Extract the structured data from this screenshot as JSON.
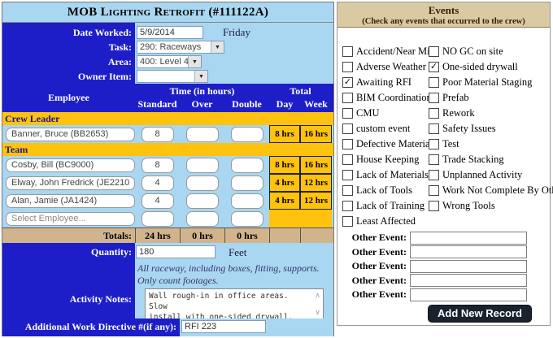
{
  "colors": {
    "dark_blue": "#1e1ec8",
    "light_blue": "#a9d7f1",
    "gold": "#ffc20e",
    "tan_totals": "#d2b48c",
    "events_header_tan": "#d9caa3",
    "button_dark": "#1b222e"
  },
  "title": "MOB Lighting Retrofit (#111122A)",
  "form": {
    "date_label": "Date Worked:",
    "date_value": "5/9/2014",
    "day_name": "Friday",
    "task_label": "Task:",
    "task_value": "290: Raceways",
    "area_label": "Area:",
    "area_value": "400: Level 4",
    "owner_label": "Owner Item:",
    "owner_value": ""
  },
  "table": {
    "headers": {
      "employee": "Employee",
      "time_group": "Time (in hours)",
      "total_group": "Total",
      "standard": "Standard",
      "over": "Over",
      "double": "Double",
      "day": "Day",
      "week": "Week"
    },
    "crew_leader_header": "Crew Leader",
    "team_header": "Team",
    "rows": [
      {
        "name": "Banner, Bruce (BB2653)",
        "standard": "8",
        "over": "",
        "double": "",
        "day": "8 hrs",
        "week": "16 hrs"
      },
      {
        "name": "Cosby, Bill (BC9000)",
        "standard": "8",
        "over": "",
        "double": "",
        "day": "8 hrs",
        "week": "16 hrs"
      },
      {
        "name": "Elway, John Fredrick (JE2210)",
        "standard": "4",
        "over": "",
        "double": "",
        "day": "4 hrs",
        "week": "12 hrs"
      },
      {
        "name": "Alan, Jamie (JA1424)",
        "standard": "4",
        "over": "",
        "double": "",
        "day": "4 hrs",
        "week": "12 hrs"
      },
      {
        "name": "Select Employee...",
        "standard": "",
        "over": "",
        "double": "",
        "day": "",
        "week": ""
      }
    ],
    "totals": {
      "label": "Totals:",
      "standard": "24 hrs",
      "over": "0 hrs",
      "double": "0 hrs"
    }
  },
  "bottom": {
    "quantity_label": "Quantity:",
    "quantity_value": "180",
    "unit": "Feet",
    "note": "All raceway, including boxes, fitting, supports. Only count footages.",
    "activity_label": "Activity Notes:",
    "activity_value": "Wall rough-in in office areas.  Slow\ninstall with one-sided drywall.",
    "directive_label": "Additional Work Directive #(if any):",
    "directive_value": "RFI 223"
  },
  "events": {
    "title": "Events",
    "subtitle": "(Check any events that occurred to the crew)",
    "left": [
      {
        "label": "Accident/Near Miss",
        "mark": ""
      },
      {
        "label": "Adverse Weather",
        "mark": ""
      },
      {
        "label": "Awaiting RFI",
        "mark": "✓"
      },
      {
        "label": "BIM Coordination",
        "mark": ""
      },
      {
        "label": "CMU",
        "mark": ""
      },
      {
        "label": "custom event",
        "mark": ""
      },
      {
        "label": "Defective Materials",
        "mark": ""
      },
      {
        "label": "House Keeping",
        "mark": ""
      },
      {
        "label": "Lack of Materials",
        "mark": ""
      },
      {
        "label": "Lack of Tools",
        "mark": ""
      },
      {
        "label": "Lack of Training",
        "mark": ""
      },
      {
        "label": "Least Affected",
        "mark": ""
      }
    ],
    "right": [
      {
        "label": "NO GC on site",
        "mark": ""
      },
      {
        "label": "One-sided drywall",
        "mark": "✓"
      },
      {
        "label": "Poor Material Staging",
        "mark": ""
      },
      {
        "label": "Prefab",
        "mark": ""
      },
      {
        "label": "Rework",
        "mark": ""
      },
      {
        "label": "Safety Issues",
        "mark": ""
      },
      {
        "label": "Test",
        "mark": ""
      },
      {
        "label": "Trade Stacking",
        "mark": ""
      },
      {
        "label": "Unplanned Activity",
        "mark": ""
      },
      {
        "label": "Work Not Complete By Others",
        "mark": ""
      },
      {
        "label": "Wrong Tools",
        "mark": ""
      }
    ],
    "other_event_label": "Other Event:",
    "other_events": [
      "",
      "",
      "",
      "",
      ""
    ],
    "add_button_label": "Add New Record",
    "select_arrow": "▼",
    "scroll_up": "∧",
    "scroll_down": "∨"
  }
}
